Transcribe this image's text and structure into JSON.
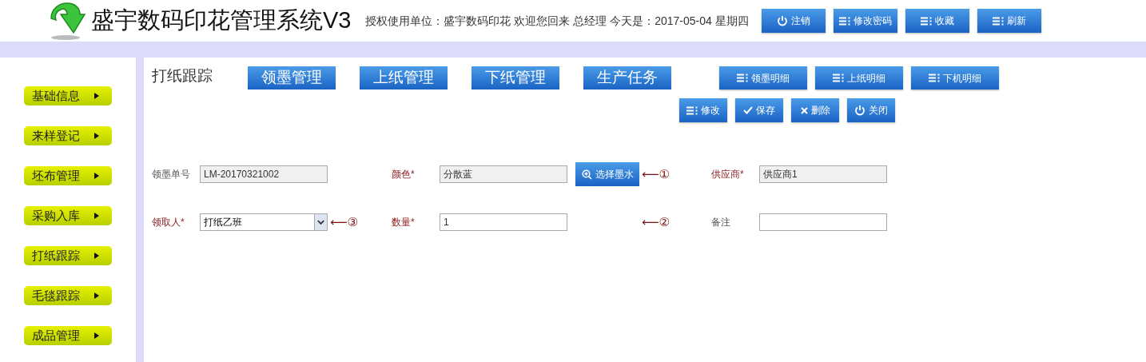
{
  "header": {
    "title": "盛宇数码印花管理系统V3",
    "info": "授权使用单位：盛宇数码印花 欢迎您回来 总经理 今天是：2017-05-04 星期四",
    "buttons": [
      {
        "label": "注销",
        "kind": "power"
      },
      {
        "label": "修改密码",
        "kind": "list"
      },
      {
        "label": "收藏",
        "kind": "list"
      },
      {
        "label": "刷新",
        "kind": "list"
      }
    ]
  },
  "sidebar": {
    "items": [
      {
        "label": "基础信息"
      },
      {
        "label": "来样登记"
      },
      {
        "label": "坯布管理"
      },
      {
        "label": "采购入库"
      },
      {
        "label": "打纸跟踪"
      },
      {
        "label": "毛毯跟踪"
      },
      {
        "label": "成品管理"
      }
    ]
  },
  "page_title": "打纸跟踪",
  "tabs": [
    {
      "label": "领墨管理"
    },
    {
      "label": "上纸管理"
    },
    {
      "label": "下纸管理"
    },
    {
      "label": "生产任务"
    }
  ],
  "detail_buttons": [
    {
      "label": "领墨明细",
      "kind": "list"
    },
    {
      "label": "上纸明细",
      "kind": "list"
    },
    {
      "label": "下机明细",
      "kind": "list"
    }
  ],
  "actions": [
    {
      "label": "修改",
      "kind": "list"
    },
    {
      "label": "保存",
      "kind": "check"
    },
    {
      "label": "删除",
      "kind": "x"
    },
    {
      "label": "关闭",
      "kind": "power"
    }
  ],
  "form": {
    "rows": [
      [
        {
          "label": "领墨单号",
          "required": false,
          "kind": "text",
          "value": "LM-20170321002",
          "readonly": true
        },
        {
          "label": "颜色*",
          "required": true,
          "kind": "text",
          "value": "分散蓝",
          "readonly": true,
          "button": {
            "label": "选择墨水"
          },
          "annotation": "⟵①"
        },
        {
          "label": "供应商*",
          "required": true,
          "kind": "text",
          "value": "供应商1",
          "readonly": true
        }
      ],
      [
        {
          "label": "领取人*",
          "required": true,
          "kind": "select",
          "value": "打纸乙班",
          "annotation": "⟵③"
        },
        {
          "label": "数量*",
          "required": true,
          "kind": "text",
          "value": "1",
          "readonly": false,
          "annotation": "⟵②"
        },
        {
          "label": "备注",
          "required": false,
          "kind": "text",
          "readonly": false
        }
      ]
    ]
  }
}
